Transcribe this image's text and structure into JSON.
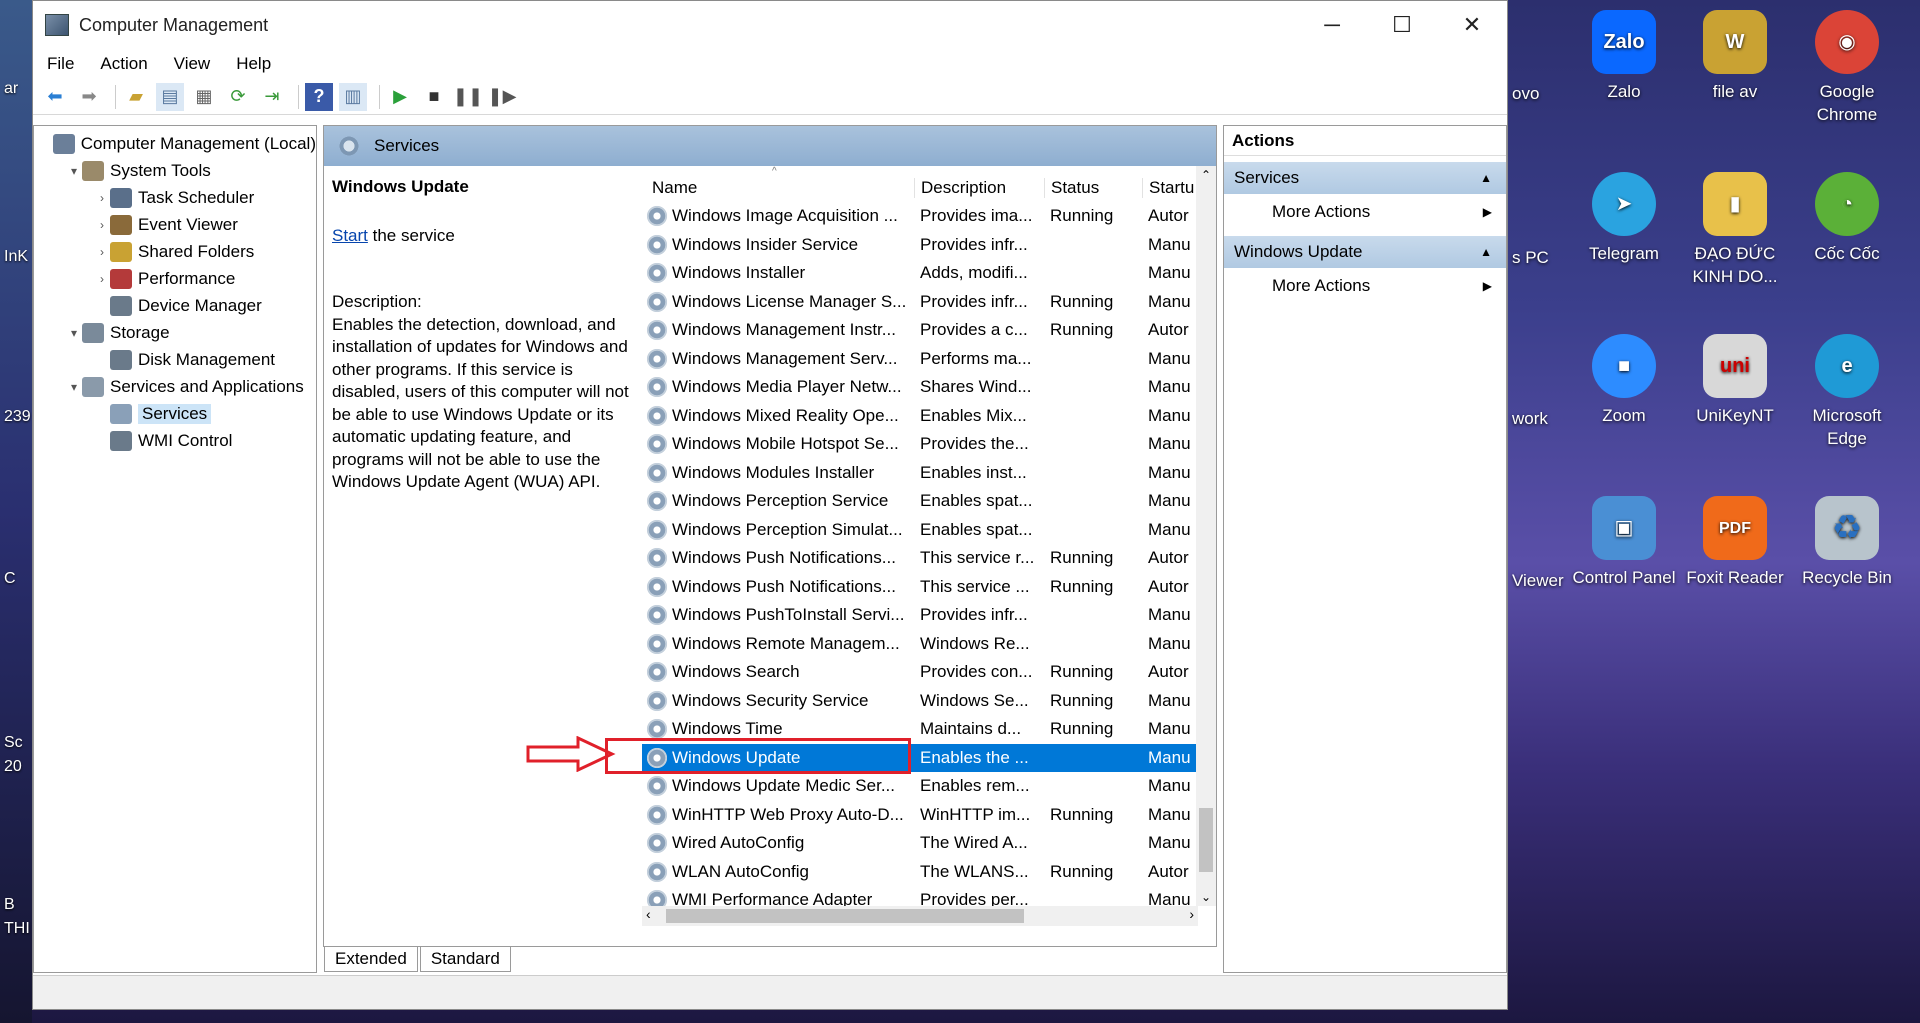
{
  "window": {
    "title": "Computer Management",
    "menu": [
      "File",
      "Action",
      "View",
      "Help"
    ]
  },
  "tree": [
    {
      "label": "Computer Management (Local)",
      "level": 0,
      "expander": "",
      "color": "#6b7f99"
    },
    {
      "label": "System Tools",
      "level": 1,
      "expander": "▾",
      "color": "#9a8a6a"
    },
    {
      "label": "Task Scheduler",
      "level": 2,
      "expander": "›",
      "color": "#5a6f8a"
    },
    {
      "label": "Event Viewer",
      "level": 2,
      "expander": "›",
      "color": "#8a6a3a"
    },
    {
      "label": "Shared Folders",
      "level": 2,
      "expander": "›",
      "color": "#c9a233"
    },
    {
      "label": "Performance",
      "level": 2,
      "expander": "›",
      "color": "#b43a3a"
    },
    {
      "label": "Device Manager",
      "level": 2,
      "expander": "",
      "color": "#6a7a8a"
    },
    {
      "label": "Storage",
      "level": 1,
      "expander": "▾",
      "color": "#7a8a9a"
    },
    {
      "label": "Disk Management",
      "level": 2,
      "expander": "",
      "color": "#6a7a8a"
    },
    {
      "label": "Services and Applications",
      "level": 1,
      "expander": "▾",
      "color": "#8a9aaa"
    },
    {
      "label": "Services",
      "level": 2,
      "expander": "",
      "color": "#8aa0b8",
      "selected": true
    },
    {
      "label": "WMI Control",
      "level": 2,
      "expander": "",
      "color": "#6a7a8a"
    }
  ],
  "center": {
    "header": "Services",
    "service_title": "Windows Update",
    "start_link": "Start",
    "start_rest": " the service",
    "description_label": "Description:",
    "description": "Enables the detection, download, and installation of updates for Windows and other programs. If this service is disabled, users of this computer will not be able to use Windows Update or its automatic updating feature, and programs will not be able to use the Windows Update Agent (WUA) API.",
    "columns": {
      "name": "Name",
      "description": "Description",
      "status": "Status",
      "startup": "Startu"
    },
    "rows": [
      {
        "name": "Windows Image Acquisition ...",
        "desc": "Provides ima...",
        "status": "Running",
        "startup": "Autor"
      },
      {
        "name": "Windows Insider Service",
        "desc": "Provides infr...",
        "status": "",
        "startup": "Manu"
      },
      {
        "name": "Windows Installer",
        "desc": "Adds, modifi...",
        "status": "",
        "startup": "Manu"
      },
      {
        "name": "Windows License Manager S...",
        "desc": "Provides infr...",
        "status": "Running",
        "startup": "Manu"
      },
      {
        "name": "Windows Management Instr...",
        "desc": "Provides a c...",
        "status": "Running",
        "startup": "Autor"
      },
      {
        "name": "Windows Management Serv...",
        "desc": "Performs ma...",
        "status": "",
        "startup": "Manu"
      },
      {
        "name": "Windows Media Player Netw...",
        "desc": "Shares Wind...",
        "status": "",
        "startup": "Manu"
      },
      {
        "name": "Windows Mixed Reality Ope...",
        "desc": "Enables Mix...",
        "status": "",
        "startup": "Manu"
      },
      {
        "name": "Windows Mobile Hotspot Se...",
        "desc": "Provides the...",
        "status": "",
        "startup": "Manu"
      },
      {
        "name": "Windows Modules Installer",
        "desc": "Enables inst...",
        "status": "",
        "startup": "Manu"
      },
      {
        "name": "Windows Perception Service",
        "desc": "Enables spat...",
        "status": "",
        "startup": "Manu"
      },
      {
        "name": "Windows Perception Simulat...",
        "desc": "Enables spat...",
        "status": "",
        "startup": "Manu"
      },
      {
        "name": "Windows Push Notifications...",
        "desc": "This service r...",
        "status": "Running",
        "startup": "Autor"
      },
      {
        "name": "Windows Push Notifications...",
        "desc": "This service ...",
        "status": "Running",
        "startup": "Autor"
      },
      {
        "name": "Windows PushToInstall Servi...",
        "desc": "Provides infr...",
        "status": "",
        "startup": "Manu"
      },
      {
        "name": "Windows Remote Managem...",
        "desc": "Windows Re...",
        "status": "",
        "startup": "Manu"
      },
      {
        "name": "Windows Search",
        "desc": "Provides con...",
        "status": "Running",
        "startup": "Autor"
      },
      {
        "name": "Windows Security Service",
        "desc": "Windows Se...",
        "status": "Running",
        "startup": "Manu"
      },
      {
        "name": "Windows Time",
        "desc": "Maintains d...",
        "status": "Running",
        "startup": "Manu"
      },
      {
        "name": "Windows Update",
        "desc": "Enables the ...",
        "status": "",
        "startup": "Manu",
        "selected": true
      },
      {
        "name": "Windows Update Medic Ser...",
        "desc": "Enables rem...",
        "status": "",
        "startup": "Manu"
      },
      {
        "name": "WinHTTP Web Proxy Auto-D...",
        "desc": "WinHTTP im...",
        "status": "Running",
        "startup": "Manu"
      },
      {
        "name": "Wired AutoConfig",
        "desc": "The Wired A...",
        "status": "",
        "startup": "Manu"
      },
      {
        "name": "WLAN AutoConfig",
        "desc": "The WLANS...",
        "status": "Running",
        "startup": "Autor"
      },
      {
        "name": "WMI Performance Adapter",
        "desc": "Provides per...",
        "status": "",
        "startup": "Manu"
      }
    ],
    "tabs": [
      "Extended",
      "Standard"
    ]
  },
  "actions": {
    "header": "Actions",
    "sections": [
      {
        "title": "Services",
        "item": "More Actions"
      },
      {
        "title": "Windows Update",
        "item": "More Actions"
      }
    ]
  },
  "desktop": {
    "icons": [
      {
        "label": "Zalo",
        "glyph": "Zalo",
        "color": "#0a68ff"
      },
      {
        "label": "file av",
        "glyph": "W",
        "color": "#c9a233"
      },
      {
        "label": "Google Chrome",
        "glyph": "◉",
        "color": "#db4437"
      },
      {
        "label": "Telegram",
        "glyph": "➤",
        "color": "#2aa3e0"
      },
      {
        "label": "ĐẠO ĐỨC KINH DO...",
        "glyph": "▮",
        "color": "#e8c14a"
      },
      {
        "label": "Cốc Cốc",
        "glyph": "◔",
        "color": "#5bb038"
      },
      {
        "label": "Zoom",
        "glyph": "■",
        "color": "#2d8cff"
      },
      {
        "label": "UniKeyNT",
        "glyph": "uni",
        "color": "#d8d8d8"
      },
      {
        "label": "Microsoft Edge",
        "glyph": "e",
        "color": "#1f9ad6"
      },
      {
        "label": "Control Panel",
        "glyph": "▣",
        "color": "#4a8fd4"
      },
      {
        "label": "Foxit Reader",
        "glyph": "PDF",
        "color": "#f06a1a"
      },
      {
        "label": "Recycle Bin",
        "glyph": "♻",
        "color": "#b8c4cc"
      }
    ],
    "partial_labels": [
      "ovo",
      "s PC",
      "work",
      "Viewer"
    ],
    "left_labels": [
      "ar",
      "InK",
      "239",
      "C",
      "Sc",
      "20",
      "B",
      "THI"
    ]
  }
}
